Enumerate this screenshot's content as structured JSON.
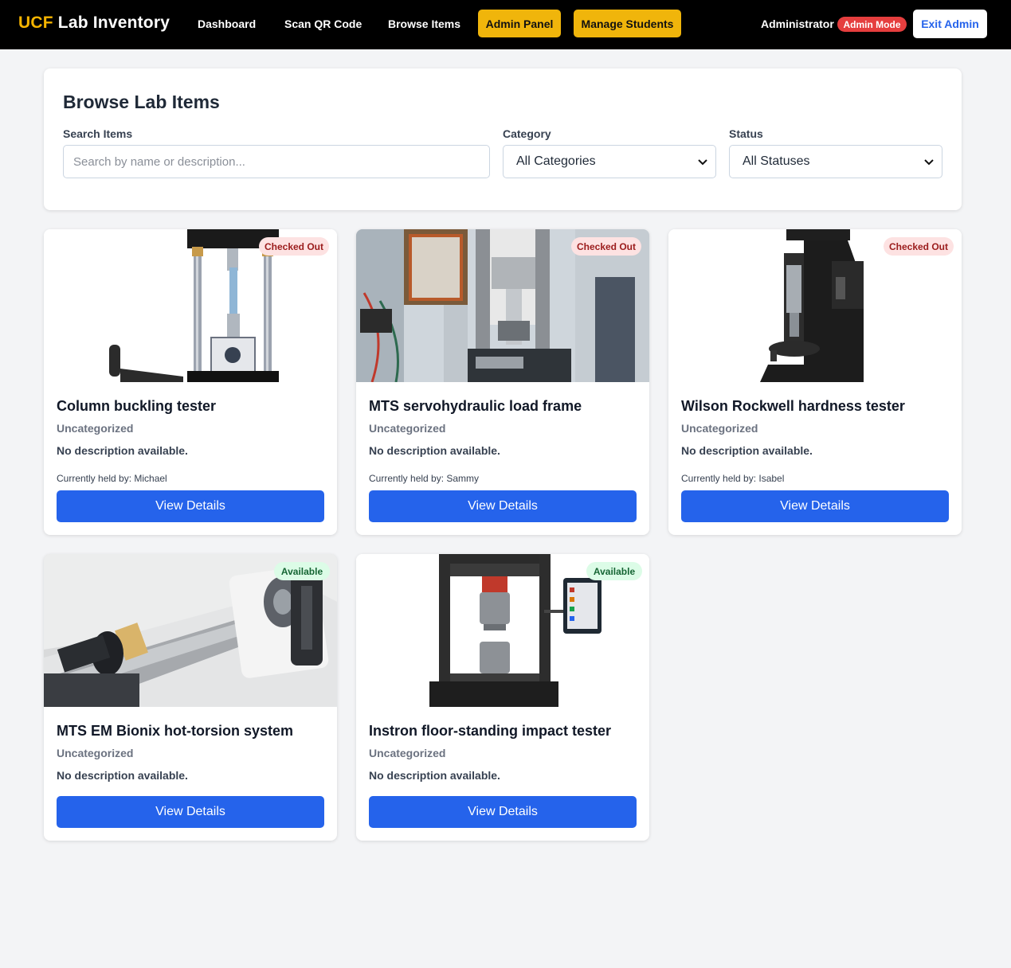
{
  "navbar": {
    "brand_prefix": "UCF",
    "brand_rest": " Lab Inventory",
    "links": [
      "Dashboard",
      "Scan QR Code",
      "Browse Items"
    ],
    "admin_buttons": [
      "Admin Panel",
      "Manage Students"
    ],
    "user_name": "Administrator",
    "mode_badge": "Admin Mode",
    "exit_label": "Exit Admin"
  },
  "filters": {
    "title": "Browse Lab Items",
    "search_label": "Search Items",
    "search_placeholder": "Search by name or description...",
    "search_value": "",
    "category_label": "Category",
    "category_selected": "All Categories",
    "status_label": "Status",
    "status_selected": "All Statuses"
  },
  "items": [
    {
      "name": "Column buckling tester",
      "category": "Uncategorized",
      "description": "No description available.",
      "status": "Checked Out",
      "held_by": "Currently held by: Michael",
      "button": "View Details"
    },
    {
      "name": "MTS servohydraulic load frame",
      "category": "Uncategorized",
      "description": "No description available.",
      "status": "Checked Out",
      "held_by": "Currently held by: Sammy",
      "button": "View Details"
    },
    {
      "name": "Wilson Rockwell hardness tester",
      "category": "Uncategorized",
      "description": "No description available.",
      "status": "Checked Out",
      "held_by": "Currently held by: Isabel",
      "button": "View Details"
    },
    {
      "name": "MTS EM Bionix hot-torsion system",
      "category": "Uncategorized",
      "description": "No description available.",
      "status": "Available",
      "held_by": "",
      "button": "View Details"
    },
    {
      "name": "Instron floor-standing impact tester",
      "category": "Uncategorized",
      "description": "No description available.",
      "status": "Available",
      "held_by": "",
      "button": "View Details"
    }
  ],
  "colors": {
    "brand_accent": "#f5b400",
    "admin_button": "#f0b50b",
    "primary": "#2563eb",
    "checked_out_badge": "#fde2e2",
    "available_badge": "#dcfce7",
    "admin_mode_badge": "#e53e3e"
  }
}
